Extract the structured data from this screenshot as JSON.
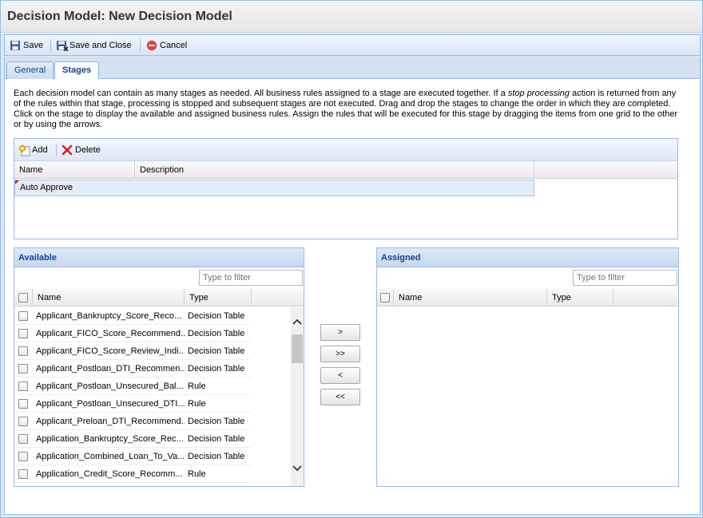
{
  "window": {
    "title": "Decision Model: New Decision Model"
  },
  "toolbar": {
    "save": "Save",
    "save_close": "Save and Close",
    "cancel": "Cancel"
  },
  "tabs": [
    {
      "label": "General"
    },
    {
      "label": "Stages"
    }
  ],
  "description": {
    "part1": "Each decision model can contain as many stages as needed. All business rules assigned to a stage are executed together. If a ",
    "emphasis": "stop processing",
    "part2": " action is returned from any of the rules within that stage, processing is stopped and subsequent stages are not executed. Drag and drop the stages to change the order in which they are completed. Click on the stage to display the available and assigned business rules. Assign the rules that will be executed for this stage by dragging the items from one grid to the other or by using the arrows."
  },
  "stages": {
    "add": "Add",
    "delete": "Delete",
    "columns": {
      "name": "Name",
      "description": "Description"
    },
    "rows": [
      {
        "name": "Auto Approve",
        "description": ""
      }
    ]
  },
  "available": {
    "title": "Available",
    "filter_placeholder": "Type to filter",
    "columns": {
      "name": "Name",
      "type": "Type"
    },
    "rows": [
      {
        "name": "Applicant_Bankruptcy_Score_Reco...",
        "type": "Decision Table"
      },
      {
        "name": "Applicant_FICO_Score_Recommend...",
        "type": "Decision Table"
      },
      {
        "name": "Applicant_FICO_Score_Review_Indi...",
        "type": "Decision Table"
      },
      {
        "name": "Applicant_Postloan_DTI_Recommen...",
        "type": "Decision Table"
      },
      {
        "name": "Applicant_Postloan_Unsecured_Bal...",
        "type": "Rule"
      },
      {
        "name": "Applicant_Postloan_Unsecured_DTI...",
        "type": "Rule"
      },
      {
        "name": "Applicant_Preloan_DTI_Recommend...",
        "type": "Decision Table"
      },
      {
        "name": "Application_Bankruptcy_Score_Rec...",
        "type": "Decision Table"
      },
      {
        "name": "Application_Combined_Loan_To_Va...",
        "type": "Decision Table"
      },
      {
        "name": "Application_Credit_Score_Recomm...",
        "type": "Rule"
      }
    ]
  },
  "arrows": {
    "move_right": ">",
    "move_all_right": ">>",
    "move_left": "<",
    "move_all_left": "<<"
  },
  "assigned": {
    "title": "Assigned",
    "filter_placeholder": "Type to filter",
    "columns": {
      "name": "Name",
      "type": "Type"
    }
  }
}
